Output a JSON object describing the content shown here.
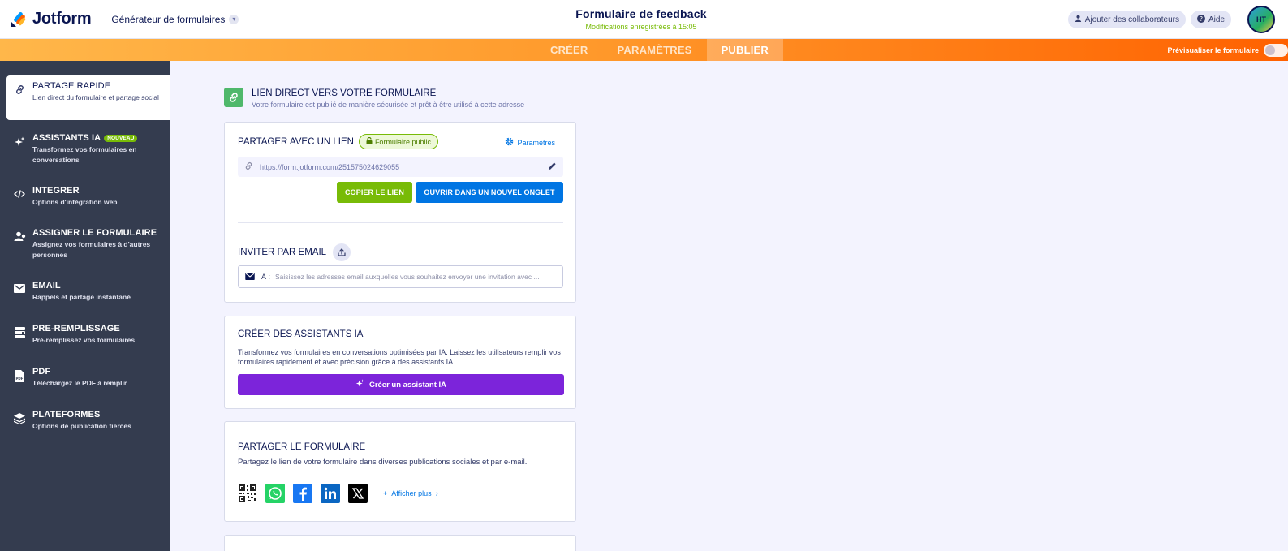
{
  "header": {
    "brand": "Jotform",
    "builder_label": "Générateur de formulaires",
    "form_title": "Formulaire de feedback",
    "save_status": "Modifications enregistrées à 15:05",
    "collaborators_label": "Ajouter des collaborateurs",
    "help_label": "Aide",
    "avatar_initials": "HT"
  },
  "nav": {
    "tabs": [
      {
        "label": "CRÉER"
      },
      {
        "label": "PARAMÈTRES"
      },
      {
        "label": "PUBLIER"
      }
    ],
    "active_tab": "PUBLIER",
    "preview_label": "Prévisualiser le formulaire"
  },
  "sidebar": {
    "items": [
      {
        "title": "PARTAGE RAPIDE",
        "desc": "Lien direct du formulaire et partage social",
        "icon": "link-icon"
      },
      {
        "title": "ASSISTANTS IA",
        "badge": "NOUVEAU",
        "desc": "Transformez vos formulaires en conversations",
        "icon": "sparkle-icon"
      },
      {
        "title": "INTEGRER",
        "desc": "Options d'intégration web",
        "icon": "code-icon"
      },
      {
        "title": "ASSIGNER LE FORMULAIRE",
        "desc": "Assignez vos formulaires à d'autres personnes",
        "icon": "assign-user-icon"
      },
      {
        "title": "EMAIL",
        "desc": "Rappels et partage instantané",
        "icon": "envelope-icon"
      },
      {
        "title": "PRE-REMPLISSAGE",
        "desc": "Pré-remplissez vos formulaires",
        "icon": "prefill-icon"
      },
      {
        "title": "PDF",
        "desc": "Téléchargez le PDF à remplir",
        "icon": "pdf-icon"
      },
      {
        "title": "PLATEFORMES",
        "desc": "Options de publication tierces",
        "icon": "layers-icon"
      }
    ]
  },
  "direct_link": {
    "title": "LIEN DIRECT VERS VOTRE FORMULAIRE",
    "subtitle": "Votre formulaire est publié de manière sécurisée et prêt à être utilisé à cette adresse"
  },
  "share_card": {
    "title": "PARTAGER AVEC UN LIEN",
    "public_label": "Formulaire public",
    "settings_label": "Paramètres",
    "url": "https://form.jotform.com/251575024629055",
    "copy_label": "COPIER LE LIEN",
    "open_label": "OUVRIR DANS UN NOUVEL ONGLET",
    "invite_title": "INVITER PAR EMAIL",
    "to_label": "À :",
    "email_placeholder": "Saisissez les adresses email auxquelles vous souhaitez envoyer une invitation avec ..."
  },
  "ai_card": {
    "title": "CRÉER DES ASSISTANTS IA",
    "desc": "Transformez vos formulaires en conversations optimisées par IA. Laissez les utilisateurs remplir vos formulaires rapidement et avec précision grâce à des assistants IA.",
    "button_label": "Créer un assistant IA"
  },
  "share_form_card": {
    "title": "PARTAGER LE FORMULAIRE",
    "desc": "Partagez le lien de votre formulaire dans diverses publications sociales et par e-mail.",
    "more_label": "Afficher plus",
    "socials": [
      "qr-code-icon",
      "whatsapp-icon",
      "facebook-icon",
      "linkedin-icon",
      "x-icon"
    ]
  },
  "colors": {
    "green": "#78bb07",
    "blue": "#0075e3",
    "purple": "#7c24da",
    "sidebar": "#343c4f",
    "orange": "#ff6100"
  }
}
